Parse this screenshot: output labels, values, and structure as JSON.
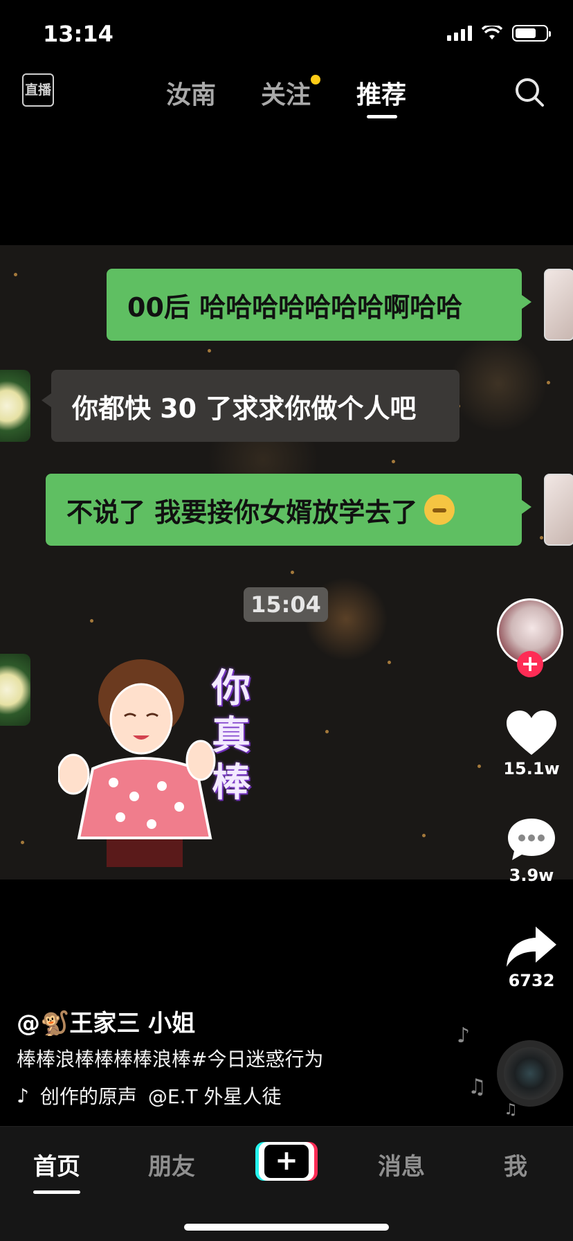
{
  "status_bar": {
    "time": "13:14"
  },
  "top_nav": {
    "live_label": "直播",
    "tabs": [
      "汝南",
      "关注",
      "推荐"
    ],
    "active_tab": "推荐"
  },
  "video": {
    "messages": [
      {
        "side": "right",
        "text": "00后 哈哈哈哈哈哈哈啊哈哈"
      },
      {
        "side": "left",
        "text": "你都快 30 了求求你做个人吧"
      },
      {
        "side": "right",
        "text": "不说了 我要接你女婿放学去了"
      }
    ],
    "timestamp": "15:04",
    "sticker_text": "你真棒"
  },
  "rail": {
    "likes": "15.1w",
    "comments": "3.9w",
    "shares": "6732"
  },
  "caption": {
    "author": "@🐒王家三 小姐",
    "description": "棒棒浪棒棒棒棒浪棒#今日迷惑行为",
    "music": "创作的原声",
    "music_author": "@E.T 外星人徒"
  },
  "bottom_nav": {
    "tabs": [
      "首页",
      "朋友",
      "消息",
      "我"
    ],
    "active_tab": "首页"
  },
  "colors": {
    "accent_red": "#fe2c55",
    "accent_cyan": "#25f4ee",
    "bubble_green": "#5fbf62",
    "notification_dot": "#ffcc16"
  }
}
